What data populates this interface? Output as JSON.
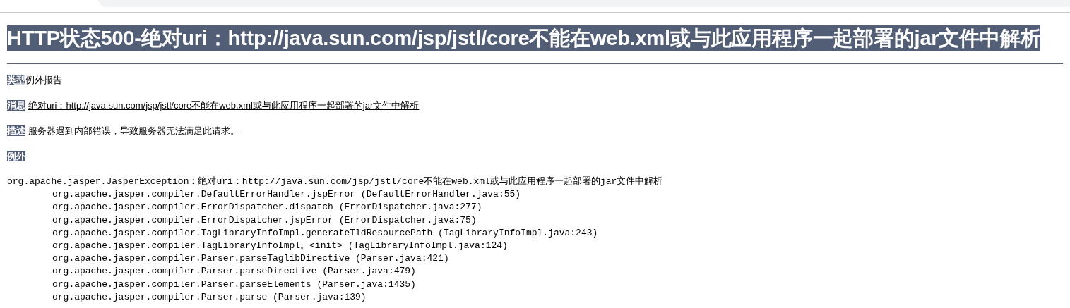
{
  "title": "HTTP状态500-绝对uri：http://java.sun.com/jsp/jstl/core不能在web.xml或与此应用程序一起部署的jar文件中解析",
  "fields": [
    {
      "label": "类型",
      "text": "例外报告",
      "underlined": false
    },
    {
      "label": "消息",
      "text": "绝对uri：http://java.sun.com/jsp/jstl/core不能在web.xml或与此应用程序一起部署的jar文件中解析",
      "underlined": true
    },
    {
      "label": "描述",
      "text": "服务器遇到内部错误，导致服务器无法满足此请求。",
      "underlined": true
    },
    {
      "label": "例外"
    }
  ],
  "stack_trace": {
    "exception": "org.apache.jasper.JasperException：绝对uri：http://java.sun.com/jsp/jstl/core不能在web.xml或与此应用程序一起部署的jar文件中解析",
    "frames": [
      "org.apache.jasper.compiler.DefaultErrorHandler.jspError (DefaultErrorHandler.java:55)",
      "org.apache.jasper.compiler.ErrorDispatcher.dispatch (ErrorDispatcher.java:277)",
      "org.apache.jasper.compiler.ErrorDispatcher.jspError (ErrorDispatcher.java:75)",
      "org.apache.jasper.compiler.TagLibraryInfoImpl.generateTldResourcePath (TagLibraryInfoImpl.java:243)",
      "org.apache.jasper.compiler.TagLibraryInfoImpl。<init> (TagLibraryInfoImpl.java:124)",
      "org.apache.jasper.compiler.Parser.parseTaglibDirective (Parser.java:421)",
      "org.apache.jasper.compiler.Parser.parseDirective (Parser.java:479)",
      "org.apache.jasper.compiler.Parser.parseElements (Parser.java:1435)",
      "org.apache.jasper.compiler.Parser.parse (Parser.java:139)"
    ]
  }
}
